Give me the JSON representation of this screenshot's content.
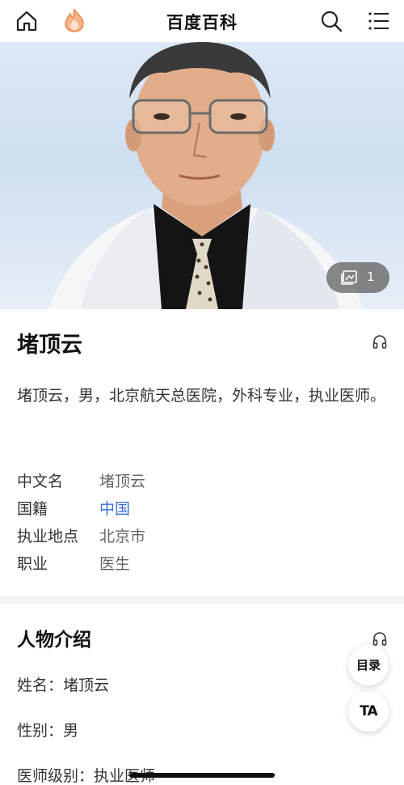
{
  "header": {
    "title": "百度百科",
    "icons": [
      "home-icon",
      "baike-flame-icon",
      "search-icon",
      "menu-icon"
    ]
  },
  "hero": {
    "photo_count": "1",
    "icons": [
      "gallery-icon"
    ]
  },
  "entry": {
    "name": "堵顶云",
    "summary": "堵顶云，男，北京航天总医院，外科专业，执业医师。",
    "info": [
      {
        "label": "中文名",
        "value": "堵顶云"
      },
      {
        "label": "国籍",
        "value": "中国"
      },
      {
        "label": "执业地点",
        "value": "北京市"
      },
      {
        "label": "职业",
        "value": "医生"
      }
    ]
  },
  "profile_section": {
    "title": "人物介绍",
    "lines": [
      "姓名：堵顶云",
      "性别：男",
      "医师级别：执业医师"
    ]
  },
  "floating": {
    "toc_label": "目录",
    "font_label": "TA"
  },
  "colors": {
    "link": "#3b6fd8",
    "flame": "#f08a4b",
    "separator": "#f2f3f5"
  }
}
